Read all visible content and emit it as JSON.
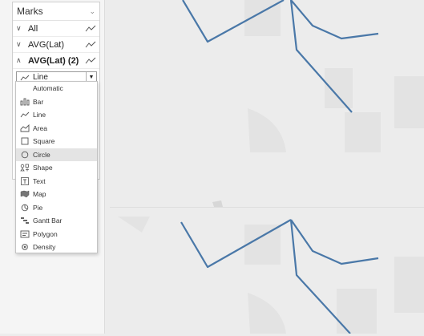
{
  "marks": {
    "title": "Marks",
    "rows": [
      {
        "label": "All"
      },
      {
        "label": "AVG(Lat)"
      },
      {
        "label": "AVG(Lat) (2)"
      }
    ],
    "selected_type": "Line"
  },
  "dropdown": {
    "items": [
      {
        "label": "Automatic",
        "icon": "none"
      },
      {
        "label": "Bar",
        "icon": "bar-icon"
      },
      {
        "label": "Line",
        "icon": "line-icon"
      },
      {
        "label": "Area",
        "icon": "area-icon"
      },
      {
        "label": "Square",
        "icon": "square-icon"
      },
      {
        "label": "Circle",
        "icon": "circle-icon"
      },
      {
        "label": "Shape",
        "icon": "shape-icon"
      },
      {
        "label": "Text",
        "icon": "text-icon"
      },
      {
        "label": "Map",
        "icon": "map-icon"
      },
      {
        "label": "Pie",
        "icon": "pie-icon"
      },
      {
        "label": "Gantt Bar",
        "icon": "gantt-icon"
      },
      {
        "label": "Polygon",
        "icon": "polygon-icon"
      },
      {
        "label": "Density",
        "icon": "density-icon"
      }
    ],
    "highlighted": "Circle"
  },
  "colors": {
    "line": "#4a78a8",
    "highlight": "#e4e4e4"
  }
}
